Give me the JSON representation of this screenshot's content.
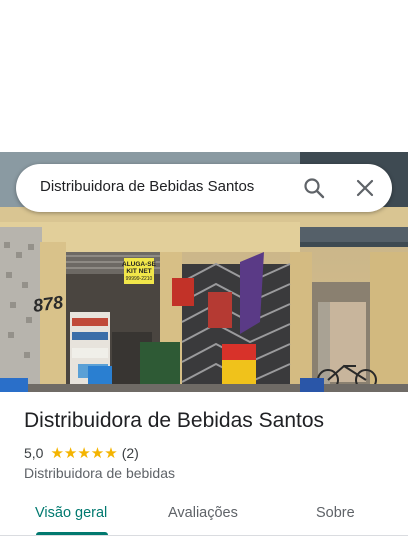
{
  "search": {
    "query": "Distribuidora de Bebidas Santos"
  },
  "hero": {
    "house_number": "878",
    "sign_rent_line1": "ALUGA-SE",
    "sign_rent_line2": "KIT NET",
    "sign_rent_phone": "99999-2210"
  },
  "place": {
    "name": "Distribuidora de Bebidas Santos",
    "rating": "5,0",
    "stars": "★★★★★",
    "review_count": "(2)",
    "category": "Distribuidora de bebidas"
  },
  "tabs": [
    {
      "label": "Visão geral",
      "active": true
    },
    {
      "label": "Avaliações",
      "active": false
    },
    {
      "label": "Sobre",
      "active": false
    }
  ],
  "colors": {
    "accent": "#01796f",
    "star": "#f4b400"
  }
}
